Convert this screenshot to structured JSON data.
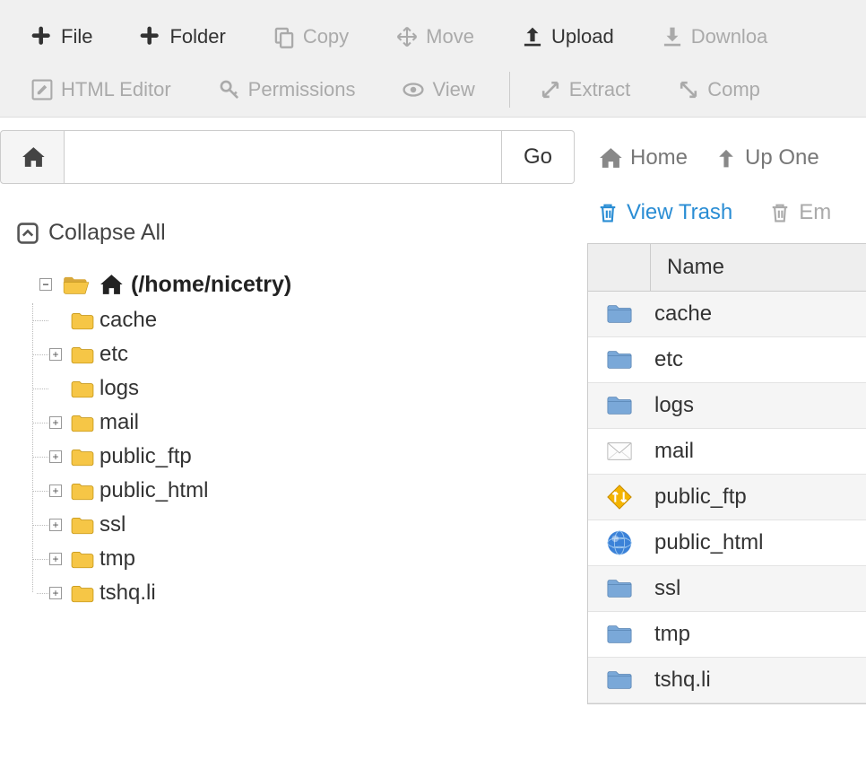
{
  "toolbar": {
    "row1": [
      {
        "name": "file-button",
        "label": "File",
        "icon": "plus",
        "state": "primary"
      },
      {
        "name": "folder-button",
        "label": "Folder",
        "icon": "plus",
        "state": "primary"
      },
      {
        "name": "copy-button",
        "label": "Copy",
        "icon": "copy",
        "state": "disabled"
      },
      {
        "name": "move-button",
        "label": "Move",
        "icon": "move",
        "state": "disabled"
      },
      {
        "name": "upload-button",
        "label": "Upload",
        "icon": "upload",
        "state": "primary"
      },
      {
        "name": "download-button",
        "label": "Downloa",
        "icon": "download",
        "state": "disabled"
      }
    ],
    "row2": [
      {
        "name": "html-editor-button",
        "label": "HTML Editor",
        "icon": "edit",
        "state": "disabled"
      },
      {
        "name": "permissions-button",
        "label": "Permissions",
        "icon": "key",
        "state": "disabled"
      },
      {
        "name": "view-button",
        "label": "View",
        "icon": "eye",
        "state": "disabled"
      },
      {
        "sep": true
      },
      {
        "name": "extract-button",
        "label": "Extract",
        "icon": "extract",
        "state": "disabled"
      },
      {
        "name": "compress-button",
        "label": "Comp",
        "icon": "compress",
        "state": "disabled"
      }
    ]
  },
  "pathbar": {
    "value": "",
    "go_label": "Go"
  },
  "collapse_all_label": "Collapse All",
  "tree": {
    "root_label": "(/home/nicetry)",
    "items": [
      {
        "label": "cache",
        "expandable": false
      },
      {
        "label": "etc",
        "expandable": true
      },
      {
        "label": "logs",
        "expandable": false
      },
      {
        "label": "mail",
        "expandable": true
      },
      {
        "label": "public_ftp",
        "expandable": true
      },
      {
        "label": "public_html",
        "expandable": true
      },
      {
        "label": "ssl",
        "expandable": true
      },
      {
        "label": "tmp",
        "expandable": true
      },
      {
        "label": "tshq.li",
        "expandable": true
      }
    ]
  },
  "right": {
    "home_label": "Home",
    "up_label": "Up One",
    "view_trash_label": "View Trash",
    "empty_trash_label": "Em"
  },
  "table": {
    "header_name": "Name",
    "rows": [
      {
        "label": "cache",
        "icon": "folder"
      },
      {
        "label": "etc",
        "icon": "folder"
      },
      {
        "label": "logs",
        "icon": "folder"
      },
      {
        "label": "mail",
        "icon": "mail"
      },
      {
        "label": "public_ftp",
        "icon": "ftp"
      },
      {
        "label": "public_html",
        "icon": "globe"
      },
      {
        "label": "ssl",
        "icon": "folder"
      },
      {
        "label": "tmp",
        "icon": "folder"
      },
      {
        "label": "tshq.li",
        "icon": "folder"
      }
    ]
  }
}
